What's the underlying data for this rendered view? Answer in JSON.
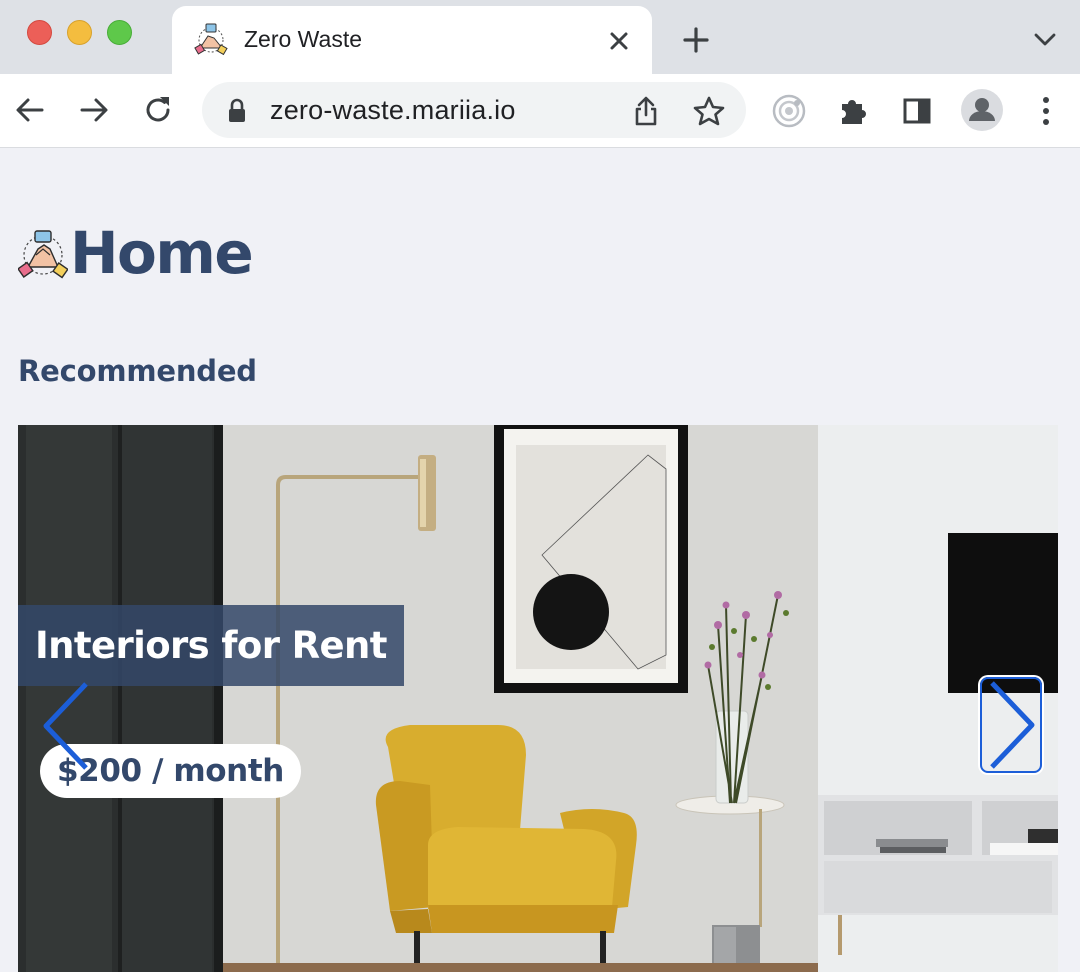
{
  "browser": {
    "tab": {
      "title": "Zero Waste",
      "favicon": "hands-together-icon"
    },
    "url": "zero-waste.mariia.io",
    "icons": [
      "back-arrow-icon",
      "forward-arrow-icon",
      "reload-icon",
      "lock-icon",
      "share-icon",
      "star-icon",
      "screen-record-icon",
      "puzzle-icon",
      "side-panel-icon",
      "profile-icon",
      "kebab-menu-icon"
    ]
  },
  "page": {
    "title": "Home",
    "logo": "hands-together-icon",
    "section_title": "Recommended",
    "carousel": {
      "slide": {
        "title": "Interiors for Rent",
        "price": "$200 / month",
        "image": "living-room-yellow-armchair"
      },
      "prev_icon": "chevron-left-icon",
      "next_icon": "chevron-right-icon"
    }
  },
  "colors": {
    "brand_text": "#33486b",
    "accent_arrow": "#1c5ed8",
    "page_bg": "#f0f1f6"
  }
}
